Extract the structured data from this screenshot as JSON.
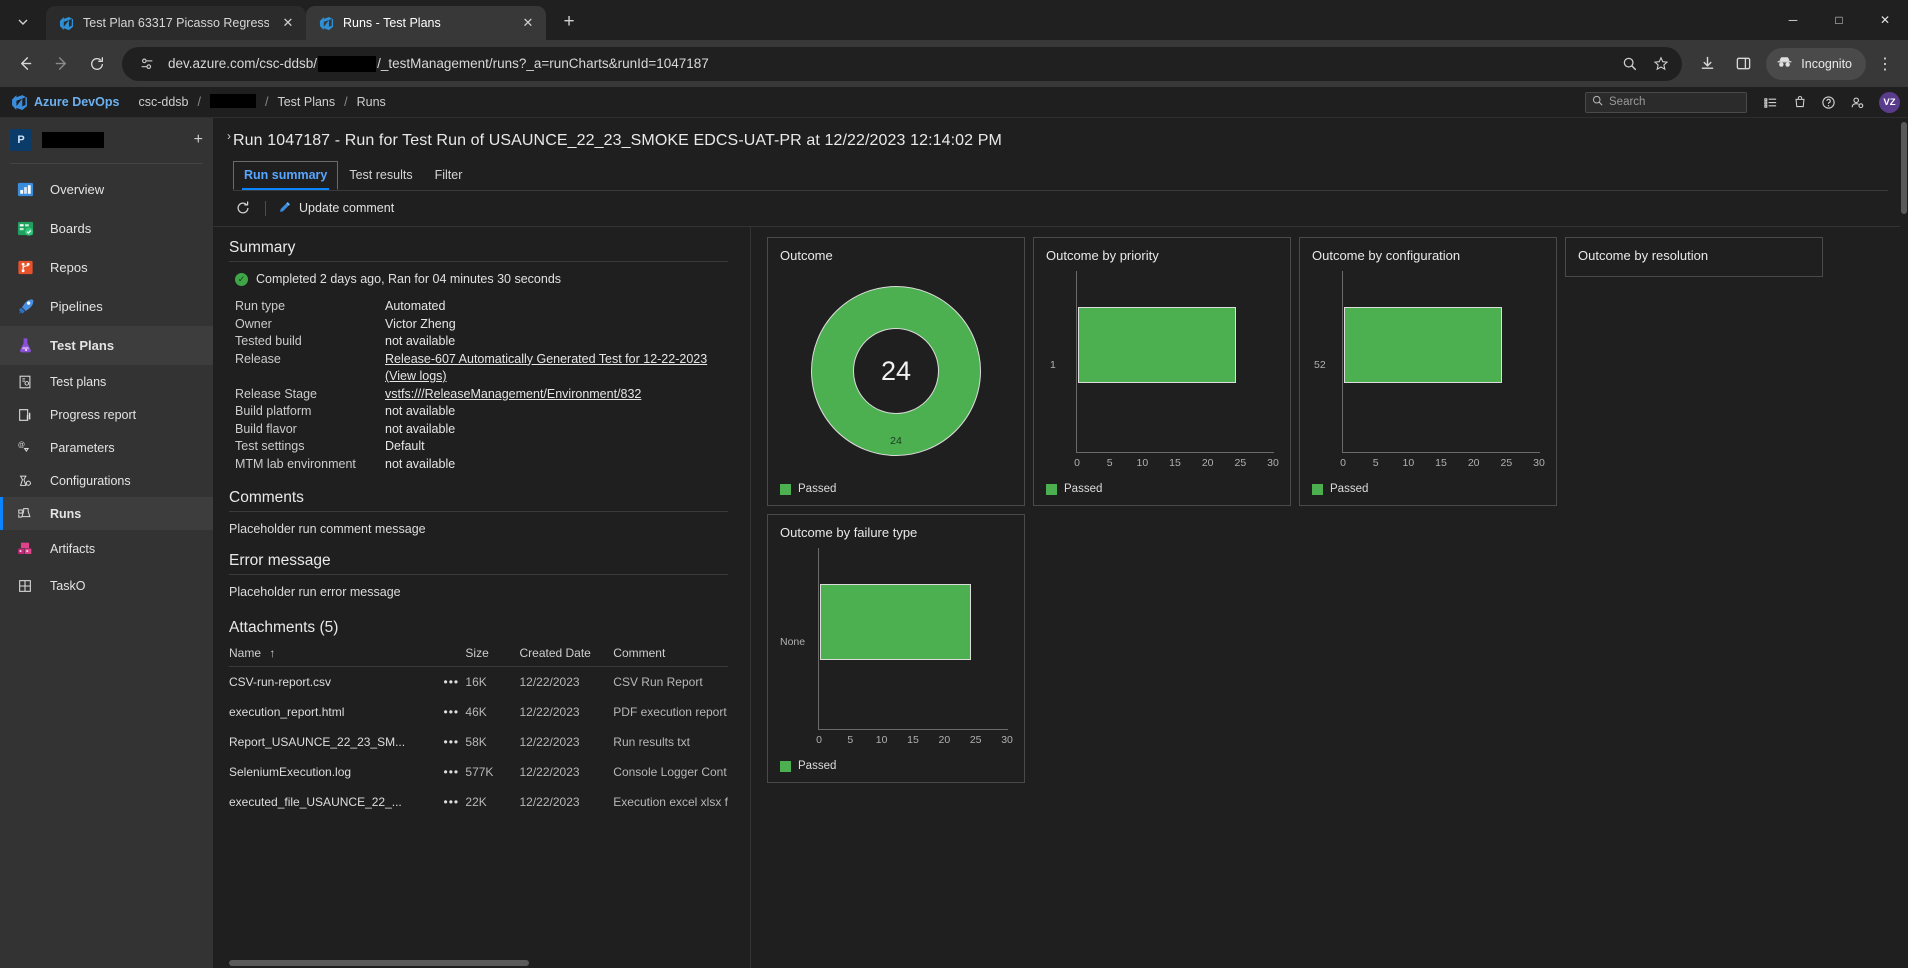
{
  "browser": {
    "tabs": [
      {
        "title": "Test Plan 63317 Picasso Regress",
        "active": false,
        "icon": "azure-devops-favicon"
      },
      {
        "title": "Runs - Test Plans",
        "active": true,
        "icon": "azure-devops-favicon"
      }
    ],
    "new_tab_label": "+",
    "tab_list_icon": "chevron-down-icon",
    "window_controls": {
      "minimize": "─",
      "maximize": "□",
      "close": "✕"
    },
    "toolbar": {
      "back_icon": "arrow-left-icon",
      "forward_icon": "arrow-right-icon",
      "reload_icon": "reload-icon",
      "site_info_icon": "site-settings-icon",
      "url_prefix": "dev.azure.com/csc-ddsb/",
      "url_suffix": "/_testManagement/runs?_a=runCharts&runId=1047187",
      "zoom_icon": "search-zoom-icon",
      "bookmark_icon": "star-icon",
      "download_icon": "download-icon",
      "split_icon": "split-screen-icon",
      "incognito_label": "Incognito",
      "incognito_icon": "incognito-hat-icon",
      "menu_icon": "kebab-menu-icon"
    }
  },
  "ado_header": {
    "brand": "Azure DevOps",
    "org": "csc-ddsb",
    "crumbs": [
      "Test Plans",
      "Runs"
    ],
    "separator": "/",
    "search_placeholder": "Search",
    "search_icon": "search-icon",
    "icons": [
      {
        "name": "boards-list-icon"
      },
      {
        "name": "shopping-bag-icon"
      },
      {
        "name": "help-icon"
      },
      {
        "name": "user-settings-icon"
      }
    ],
    "avatar_initials": "VZ"
  },
  "sidebar": {
    "project_badge": "P",
    "add_icon": "plus-icon",
    "collapse_icon": "chevron-right-icon",
    "hubs": [
      {
        "label": "Overview",
        "icon": "overview-icon",
        "active": false
      },
      {
        "label": "Boards",
        "icon": "boards-icon",
        "active": false
      },
      {
        "label": "Repos",
        "icon": "repos-icon",
        "active": false
      },
      {
        "label": "Pipelines",
        "icon": "pipelines-icon",
        "active": false
      },
      {
        "label": "Test Plans",
        "icon": "test-plans-flask-icon",
        "active": true
      }
    ],
    "sub_items": [
      {
        "label": "Test plans",
        "icon": "test-plans-item-icon",
        "active": false
      },
      {
        "label": "Progress report",
        "icon": "progress-report-icon",
        "active": false
      },
      {
        "label": "Parameters",
        "icon": "parameters-icon",
        "active": false
      },
      {
        "label": "Configurations",
        "icon": "configurations-icon",
        "active": false
      },
      {
        "label": "Runs",
        "icon": "runs-icon",
        "active": true
      },
      {
        "label": "Artifacts",
        "icon": "artifacts-icon",
        "active": false
      },
      {
        "label": "TaskO",
        "icon": "tasko-grid-icon",
        "active": false
      }
    ]
  },
  "main": {
    "run_title": "Run 1047187 - Run for Test Run of USAUNCE_22_23_SMOKE EDCS-UAT-PR at 12/22/2023 12:14:02 PM",
    "tabs": [
      {
        "label": "Run summary",
        "active": true
      },
      {
        "label": "Test results",
        "active": false
      },
      {
        "label": "Filter",
        "active": false
      }
    ],
    "commandbar": {
      "refresh_icon": "refresh-icon",
      "update_comment_label": "Update comment",
      "update_comment_icon": "pencil-edit-icon"
    },
    "summary": {
      "heading": "Summary",
      "status_icon": "check-circle-icon",
      "status_text": "Completed 2 days ago, Ran for 04 minutes 30 seconds",
      "fields": [
        {
          "key": "Run type",
          "value": "Automated",
          "link": false
        },
        {
          "key": "Owner",
          "value": "Victor Zheng",
          "link": false
        },
        {
          "key": "Tested build",
          "value": "not available",
          "link": false
        },
        {
          "key": "Release",
          "value": "Release-607 Automatically Generated Test for 12-22-2023 (View logs)",
          "link": true
        },
        {
          "key": "Release Stage",
          "value": "vstfs:///ReleaseManagement/Environment/832",
          "link": true
        },
        {
          "key": "Build platform",
          "value": "not available",
          "link": false
        },
        {
          "key": "Build flavor",
          "value": "not available",
          "link": false
        },
        {
          "key": "Test settings",
          "value": "Default",
          "link": false
        },
        {
          "key": "MTM lab environment",
          "value": "not available",
          "link": false
        }
      ]
    },
    "comments": {
      "heading": "Comments",
      "text": "Placeholder run comment message"
    },
    "error_message": {
      "heading": "Error message",
      "text": "Placeholder run error message"
    },
    "attachments": {
      "heading": "Attachments (5)",
      "columns": [
        "Name",
        "Size",
        "Created Date",
        "Comment"
      ],
      "sort_icon": "sort-ascending-arrow",
      "more_icon": "ellipsis-icon",
      "rows": [
        {
          "name": "CSV-run-report.csv",
          "size": "16K",
          "date": "12/22/2023",
          "comment": "CSV Run Report"
        },
        {
          "name": "execution_report.html",
          "size": "46K",
          "date": "12/22/2023",
          "comment": "PDF execution report"
        },
        {
          "name": "Report_USAUNCE_22_23_SM...",
          "size": "58K",
          "date": "12/22/2023",
          "comment": "Run results txt"
        },
        {
          "name": "SeleniumExecution.log",
          "size": "577K",
          "date": "12/22/2023",
          "comment": "Console Logger Cont"
        },
        {
          "name": "executed_file_USAUNCE_22_...",
          "size": "22K",
          "date": "12/22/2023",
          "comment": "Execution excel xlsx f"
        }
      ]
    }
  },
  "chart_data": [
    {
      "type": "pie",
      "title": "Outcome",
      "variant": "donut",
      "center_label": "24",
      "slice_label": "24",
      "categories": [
        "Passed"
      ],
      "values": [
        24
      ],
      "colors": [
        "#4caf50"
      ],
      "legend": [
        "Passed"
      ],
      "legend_position": "bottom-left"
    },
    {
      "type": "bar",
      "title": "Outcome by priority",
      "orientation": "horizontal",
      "categories": [
        "1"
      ],
      "series": [
        {
          "name": "Passed",
          "values": [
            24
          ]
        }
      ],
      "colors": [
        "#4caf50"
      ],
      "xlabel": "",
      "ylabel": "",
      "xticks": [
        0,
        5,
        10,
        15,
        20,
        25,
        30
      ],
      "xlim": [
        0,
        30
      ],
      "legend": [
        "Passed"
      ],
      "grid": false
    },
    {
      "type": "bar",
      "title": "Outcome by configuration",
      "orientation": "horizontal",
      "categories": [
        "52"
      ],
      "series": [
        {
          "name": "Passed",
          "values": [
            24
          ]
        }
      ],
      "colors": [
        "#4caf50"
      ],
      "xlabel": "",
      "ylabel": "",
      "xticks": [
        0,
        5,
        10,
        15,
        20,
        25,
        30
      ],
      "xlim": [
        0,
        30
      ],
      "legend": [
        "Passed"
      ],
      "grid": false
    },
    {
      "type": "bar",
      "title": "Outcome by failure type",
      "orientation": "horizontal",
      "categories": [
        "None"
      ],
      "series": [
        {
          "name": "Passed",
          "values": [
            24
          ]
        }
      ],
      "colors": [
        "#4caf50"
      ],
      "xlabel": "",
      "ylabel": "",
      "xticks": [
        0,
        5,
        10,
        15,
        20,
        25,
        30
      ],
      "xlim": [
        0,
        30
      ],
      "legend": [
        "Passed"
      ],
      "grid": false
    },
    {
      "type": "bar",
      "title": "Outcome by resolution",
      "orientation": "horizontal",
      "categories": [],
      "series": [
        {
          "name": "Passed",
          "values": []
        }
      ],
      "colors": [
        "#4caf50"
      ],
      "xticks": [],
      "legend": [],
      "grid": false
    }
  ]
}
